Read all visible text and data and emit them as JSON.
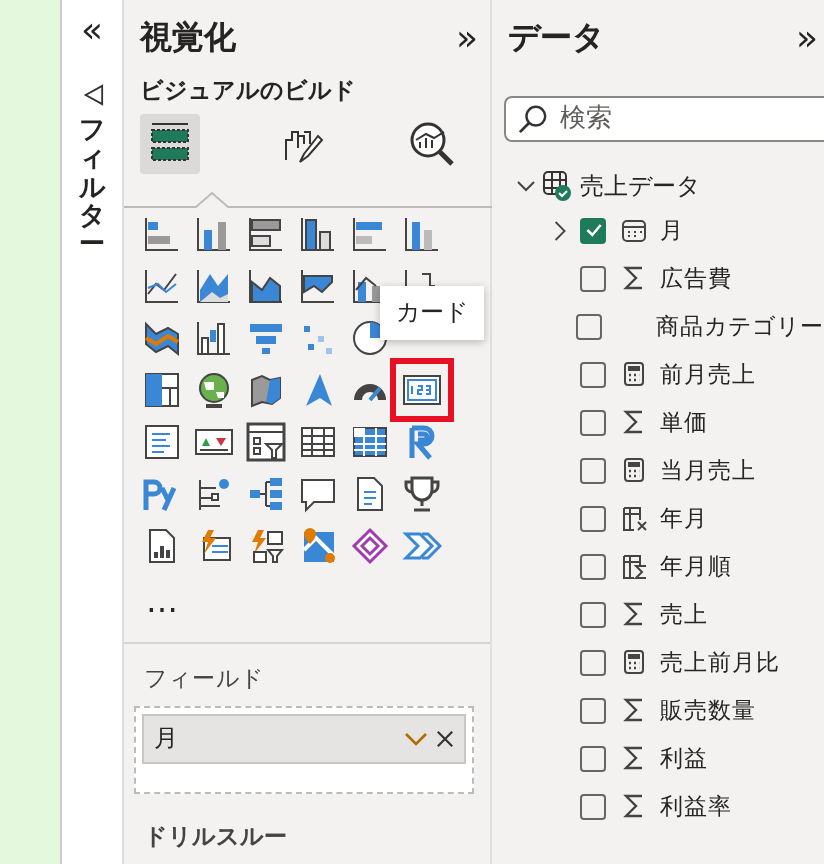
{
  "filters_pane": {
    "collapse": "«",
    "title": "フィルター"
  },
  "visualizations": {
    "title": "視覚化",
    "expand": "»",
    "section": "ビジュアルのビルド",
    "modes": [
      {
        "selected": true
      },
      {
        "selected": false
      },
      {
        "selected": false
      }
    ],
    "visual_rows": [
      [
        {
          "selected": false
        },
        {
          "selected": false
        },
        {
          "selected": false
        },
        {
          "selected": false
        },
        {
          "selected": false
        },
        {
          "selected": false
        }
      ],
      [
        {
          "selected": false
        },
        {
          "selected": false
        },
        {
          "selected": false
        },
        {
          "selected": false
        },
        {
          "selected": false
        },
        {
          "selected": false
        }
      ],
      [
        {
          "selected": false
        },
        {
          "selected": false
        },
        {
          "selected": false
        },
        {
          "selected": false
        },
        {
          "selected": false
        }
      ],
      [
        {
          "selected": false
        },
        {
          "selected": false
        },
        {
          "selected": false
        },
        {
          "selected": false
        },
        {
          "selected": false
        },
        {
          "selected": true
        }
      ],
      [
        {
          "selected": false
        },
        {
          "selected": false
        },
        {
          "selected": false
        },
        {
          "selected": false
        },
        {
          "selected": false
        },
        {
          "selected": false
        }
      ],
      [
        {
          "selected": false
        },
        {
          "selected": false
        },
        {
          "selected": false
        },
        {
          "selected": false
        },
        {
          "selected": false
        },
        {
          "selected": false
        }
      ],
      [
        {
          "selected": false
        },
        {
          "selected": false
        },
        {
          "selected": false
        },
        {
          "selected": false
        },
        {
          "selected": false
        },
        {
          "selected": false
        }
      ]
    ],
    "more": "…",
    "tooltip": "カード",
    "fields_label": "フィールド",
    "field_well": [
      {
        "name": "月"
      }
    ],
    "drillthrough": "ドリルスルー"
  },
  "data": {
    "title": "データ",
    "expand": "»",
    "search": {
      "placeholder": "検索"
    },
    "tables": [
      {
        "name": "売上データ",
        "expanded": true,
        "fields": [
          {
            "name": "月",
            "kind": "calendar",
            "checked": true,
            "expanded": false
          },
          {
            "name": "広告費",
            "kind": "sum",
            "checked": false
          },
          {
            "name": "商品カテゴリー",
            "kind": "text",
            "checked": false
          },
          {
            "name": "前月売上",
            "kind": "measure",
            "checked": false
          },
          {
            "name": "単価",
            "kind": "sum",
            "checked": false
          },
          {
            "name": "当月売上",
            "kind": "measure",
            "checked": false
          },
          {
            "name": "年月",
            "kind": "formula",
            "checked": false
          },
          {
            "name": "年月順",
            "kind": "sort",
            "checked": false
          },
          {
            "name": "売上",
            "kind": "sum",
            "checked": false
          },
          {
            "name": "売上前月比",
            "kind": "measure",
            "checked": false
          },
          {
            "name": "販売数量",
            "kind": "sum",
            "checked": false
          },
          {
            "name": "利益",
            "kind": "sum",
            "checked": false
          },
          {
            "name": "利益率",
            "kind": "sum",
            "checked": false
          }
        ]
      }
    ]
  }
}
